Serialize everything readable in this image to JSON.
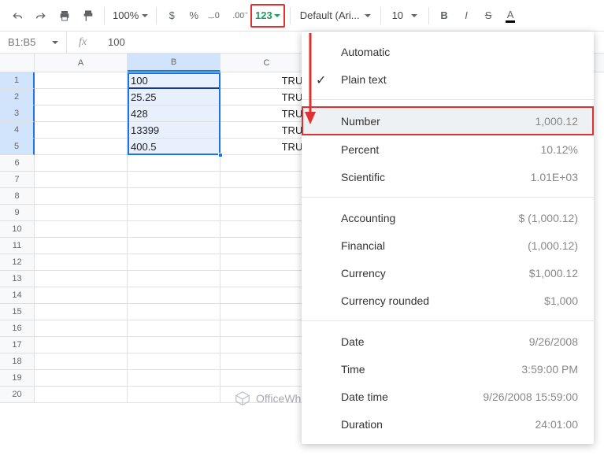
{
  "toolbar": {
    "zoom": "100%",
    "currency": "$",
    "percent": "%",
    "dec_less": ".0",
    "dec_more": ".00",
    "numfmt": "123",
    "font": "Default (Ari...",
    "size": "10",
    "bold": "B",
    "italic": "I",
    "strike": "S",
    "textcolor": "A"
  },
  "formula_bar": {
    "namebox": "B1:B5",
    "fx": "fx",
    "value": "100"
  },
  "columns": [
    "A",
    "B",
    "C"
  ],
  "rows": [
    {
      "n": "1",
      "b": "100",
      "c": "TRUE"
    },
    {
      "n": "2",
      "b": "25.25",
      "c": "TRUE"
    },
    {
      "n": "3",
      "b": "428",
      "c": "TRUE"
    },
    {
      "n": "4",
      "b": "13399",
      "c": "TRUE"
    },
    {
      "n": "5",
      "b": "400.5",
      "c": "TRUE"
    },
    {
      "n": "6",
      "b": "",
      "c": ""
    },
    {
      "n": "7",
      "b": "",
      "c": ""
    },
    {
      "n": "8",
      "b": "",
      "c": ""
    },
    {
      "n": "9",
      "b": "",
      "c": ""
    },
    {
      "n": "10",
      "b": "",
      "c": ""
    },
    {
      "n": "11",
      "b": "",
      "c": ""
    },
    {
      "n": "12",
      "b": "",
      "c": ""
    },
    {
      "n": "13",
      "b": "",
      "c": ""
    },
    {
      "n": "14",
      "b": "",
      "c": ""
    },
    {
      "n": "15",
      "b": "",
      "c": ""
    },
    {
      "n": "16",
      "b": "",
      "c": ""
    },
    {
      "n": "17",
      "b": "",
      "c": ""
    },
    {
      "n": "18",
      "b": "",
      "c": ""
    },
    {
      "n": "19",
      "b": "",
      "c": ""
    },
    {
      "n": "20",
      "b": "",
      "c": ""
    }
  ],
  "menu": {
    "automatic": "Automatic",
    "plaintext": "Plain text",
    "number": {
      "label": "Number",
      "ex": "1,000.12"
    },
    "percent": {
      "label": "Percent",
      "ex": "10.12%"
    },
    "scientific": {
      "label": "Scientific",
      "ex": "1.01E+03"
    },
    "accounting": {
      "label": "Accounting",
      "ex": "$ (1,000.12)"
    },
    "financial": {
      "label": "Financial",
      "ex": "(1,000.12)"
    },
    "currency": {
      "label": "Currency",
      "ex": "$1,000.12"
    },
    "currency_rounded": {
      "label": "Currency rounded",
      "ex": "$1,000"
    },
    "date": {
      "label": "Date",
      "ex": "9/26/2008"
    },
    "time": {
      "label": "Time",
      "ex": "3:59:00 PM"
    },
    "datetime": {
      "label": "Date time",
      "ex": "9/26/2008 15:59:00"
    },
    "duration": {
      "label": "Duration",
      "ex": "24:01:00"
    }
  },
  "watermark": "OfficeWheel"
}
